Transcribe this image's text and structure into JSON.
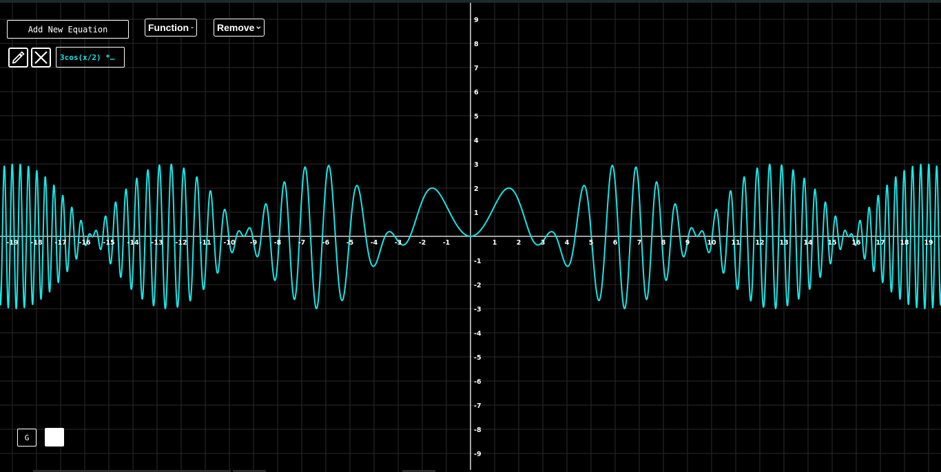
{
  "toolbar": {
    "add_equation_label": "Add New Equation",
    "function_select_value": "Function",
    "remove_select_value": "Remove"
  },
  "equation_list": [
    {
      "chip_text": "3cos(x/2) *…"
    }
  ],
  "controls": {
    "grid_toggle_label": "G"
  },
  "icons": {
    "edit": "pencil-icon",
    "delete": "close-icon",
    "dropdown": "chevron-down-icon"
  },
  "colors": {
    "background": "#000000",
    "curve": "#19e6e6",
    "axis": "#ffffff",
    "grid": "#2b2b2b",
    "tick_label": "#ffffff"
  },
  "chart_data": {
    "type": "line",
    "xlim": [
      -20.1,
      20.1
    ],
    "ylim": [
      -9.5,
      9.5
    ],
    "grid": true,
    "x_ticks": [
      -19,
      -18,
      -17,
      -16,
      -15,
      -14,
      -13,
      -12,
      -11,
      -10,
      -9,
      -8,
      -7,
      -6,
      -5,
      -4,
      -3,
      -2,
      -1,
      1,
      2,
      3,
      4,
      5,
      6,
      7,
      8,
      9,
      10,
      11,
      12,
      13,
      14,
      15,
      16,
      17,
      18,
      19
    ],
    "y_ticks": [
      9,
      8,
      7,
      6,
      5,
      4,
      3,
      2,
      1,
      -1,
      -2,
      -3,
      -4,
      -5,
      -6,
      -7,
      -8,
      -9
    ],
    "series": [
      {
        "expression": "3cos(x/2) * sin(x^2/2)"
      }
    ]
  }
}
